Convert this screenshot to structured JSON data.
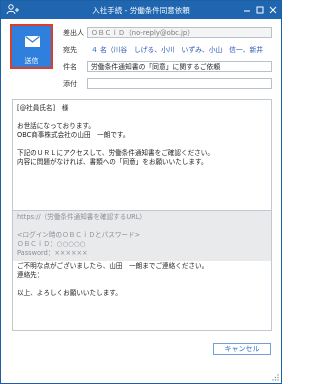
{
  "window": {
    "title": "入社手続 - 労働条件同意依頼"
  },
  "toolbar": {
    "send_label": "送信"
  },
  "fields": {
    "from_label": "差出人",
    "from_value": "ＯＢＣｉＤ（no-reply@obc.jp）",
    "to_label": "宛先",
    "to_value": "４ 名（川谷　しげる、小川　いずみ、小山　信一、新井",
    "subject_label": "件名",
    "subject_value": "労働条件通知書の「同意」に関するご依頼",
    "attachment_label": "添付",
    "attachment_value": ""
  },
  "body": {
    "line1": "[@社員氏名]　様",
    "line2": "お世話になっております。",
    "line3": "OBC商事株式会社の山田　一朗です。",
    "line4": "下記のＵＲＬにアクセスして、労働条件通知書をご確認ください。",
    "line5": "内容に問題がなければ、書類への「同意」をお願いいたします。"
  },
  "template": {
    "url_line": "https://（労働条件通知書を確認するURL）",
    "login_header": "<ログイン時のＯＢＣｉＤとパスワード>",
    "id_line": "ＯＢＣｉＤ：○○○○○",
    "password_line": "Password：××××××"
  },
  "footer": {
    "line1": "ご不明な点がございましたら、山田　一朗までご連絡ください。",
    "line2": "連絡先：",
    "line3": "以上、よろしくお願いいたします。"
  },
  "actions": {
    "cancel_label": "キャンセル"
  },
  "colors": {
    "titlebar": "#1f65b0",
    "send_button": "#2f7fdc",
    "send_button_border": "#d8402e",
    "link_text": "#2255b8"
  },
  "icons": {
    "app": "user-add-icon",
    "send": "envelope-icon",
    "minimize": "minimize-icon",
    "maximize": "maximize-icon",
    "close": "close-icon",
    "resize": "resize-grip-icon"
  }
}
